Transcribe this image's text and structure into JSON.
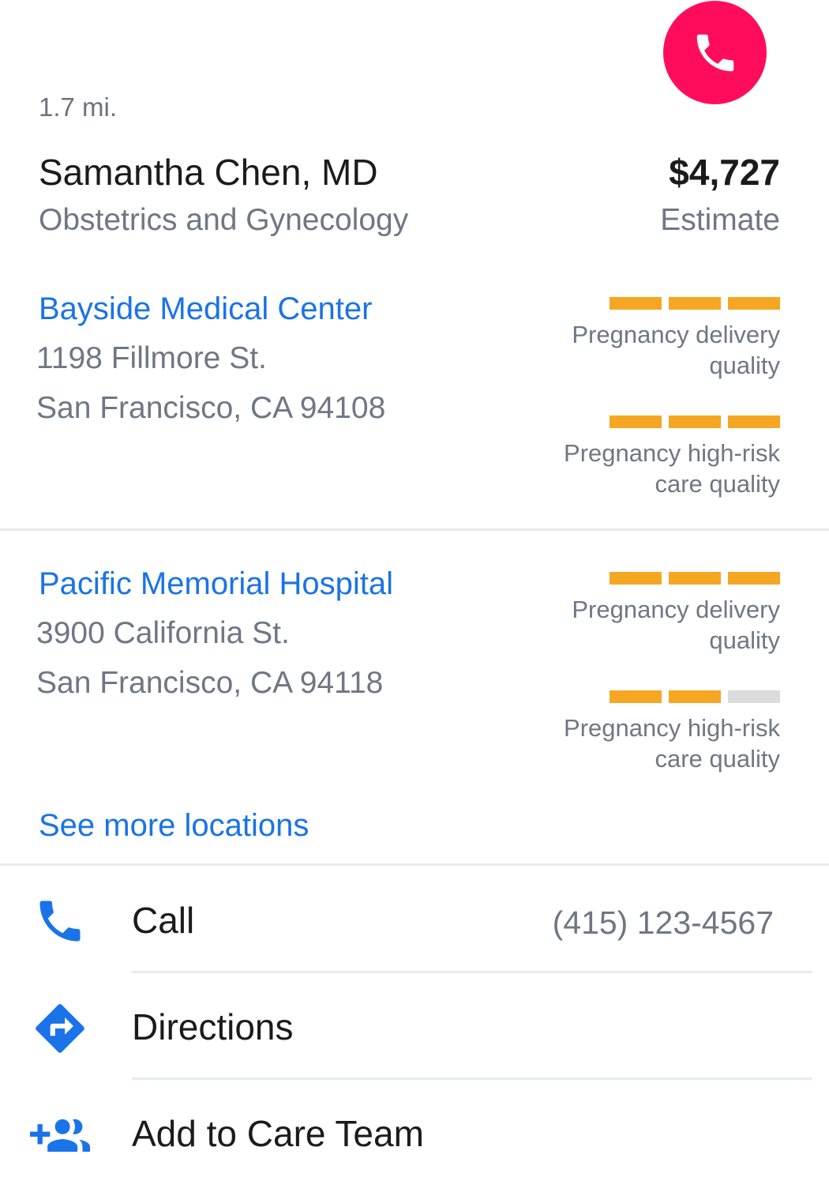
{
  "provider": {
    "distance": "1.7 mi.",
    "name": "Samantha Chen, MD",
    "specialty": "Obstetrics and Gynecology",
    "price": "$4,727",
    "price_label": "Estimate"
  },
  "locations": [
    {
      "name": "Bayside Medical Center",
      "address_line1": "1198 Fillmore St.",
      "address_line2": "San Francisco, CA 94108",
      "ratings": [
        {
          "label_line1": "Pregnancy delivery",
          "label_line2": "quality",
          "score": 3,
          "max": 3
        },
        {
          "label_line1": "Pregnancy high-risk",
          "label_line2": "care quality",
          "score": 3,
          "max": 3
        }
      ]
    },
    {
      "name": "Pacific Memorial Hospital",
      "address_line1": "3900 California St.",
      "address_line2": "San Francisco, CA 94118",
      "ratings": [
        {
          "label_line1": "Pregnancy delivery",
          "label_line2": "quality",
          "score": 3,
          "max": 3
        },
        {
          "label_line1": "Pregnancy high-risk",
          "label_line2": "care quality",
          "score": 2,
          "max": 3
        }
      ]
    }
  ],
  "see_more": "See more locations",
  "actions": {
    "call": {
      "label": "Call",
      "value": "(415) 123-4567",
      "icon": "phone-icon"
    },
    "directions": {
      "label": "Directions",
      "icon": "directions-icon"
    },
    "add_care_team": {
      "label": "Add to Care Team",
      "icon": "add-group-icon"
    }
  },
  "colors": {
    "accent": "#1a73e8",
    "fab": "#ff0d5c",
    "rating_on": "#f5a623",
    "rating_off": "#dcdcdc"
  }
}
